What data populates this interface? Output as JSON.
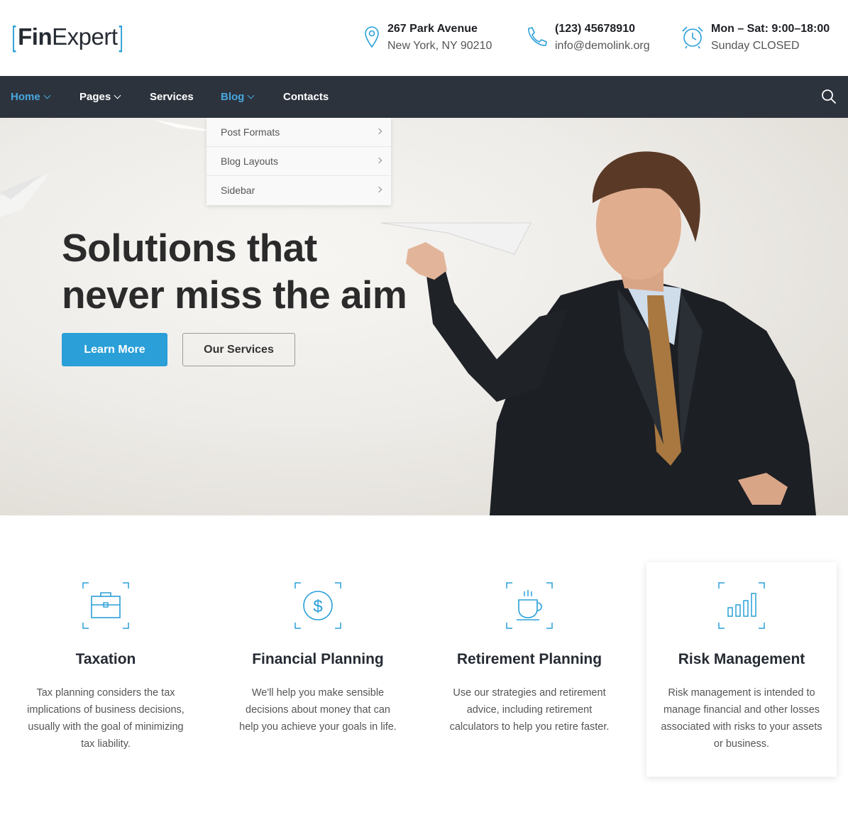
{
  "logo": {
    "part1": "Fin",
    "part2": "Expert"
  },
  "contacts": [
    {
      "icon": "map-pin-icon",
      "line1": "267 Park Avenue",
      "line2": "New York, NY 90210"
    },
    {
      "icon": "phone-icon",
      "line1": "(123) 45678910",
      "line2": "info@demolink.org"
    },
    {
      "icon": "alarm-clock-icon",
      "line1": "Mon – Sat: 9:00–18:00",
      "line2": "Sunday CLOSED"
    }
  ],
  "nav": {
    "items": [
      {
        "label": "Home",
        "has_dropdown": true,
        "active": true
      },
      {
        "label": "Pages",
        "has_dropdown": true,
        "active": false
      },
      {
        "label": "Services",
        "has_dropdown": false,
        "active": false
      },
      {
        "label": "Blog",
        "has_dropdown": true,
        "active": true
      },
      {
        "label": "Contacts",
        "has_dropdown": false,
        "active": false
      }
    ],
    "search_icon": "search-icon"
  },
  "dropdown": {
    "items": [
      "Post Formats",
      "Blog Layouts",
      "Sidebar"
    ]
  },
  "hero": {
    "title_line1": "Solutions that",
    "title_line2": "never miss the aim",
    "primary_button": "Learn More",
    "secondary_button": "Our Services"
  },
  "services": [
    {
      "icon": "briefcase-icon",
      "title": "Taxation",
      "text": "Tax planning considers the tax implications of business decisions, usually with the goal of minimizing tax liability."
    },
    {
      "icon": "dollar-coin-icon",
      "title": "Financial Planning",
      "text": "We'll help you make sensible decisions about money that can help you achieve your goals in life."
    },
    {
      "icon": "coffee-cup-icon",
      "title": "Retirement Planning",
      "text": "Use our strategies and retirement advice, including retirement calculators to help you retire faster."
    },
    {
      "icon": "bar-chart-icon",
      "title": "Risk Management",
      "text": "Risk management is intended to manage financial and other losses associated with risks to your assets or business."
    }
  ],
  "colors": {
    "accent": "#2a9fd8",
    "nav_bg": "#2d333d",
    "nav_active": "#47a8df"
  }
}
